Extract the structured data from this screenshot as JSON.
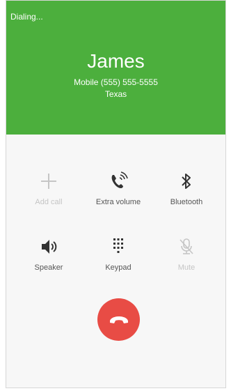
{
  "call": {
    "status": "Dialing...",
    "name": "James",
    "number": "Mobile (555) 555-5555",
    "location": "Texas"
  },
  "controls": [
    {
      "label": "Add call",
      "icon": "plus-icon",
      "enabled": false
    },
    {
      "label": "Extra volume",
      "icon": "phone-volume-icon",
      "enabled": true
    },
    {
      "label": "Bluetooth",
      "icon": "bluetooth-icon",
      "enabled": true
    },
    {
      "label": "Speaker",
      "icon": "speaker-icon",
      "enabled": true
    },
    {
      "label": "Keypad",
      "icon": "keypad-icon",
      "enabled": true
    },
    {
      "label": "Mute",
      "icon": "mute-mic-icon",
      "enabled": false
    }
  ],
  "end_call": {
    "icon": "end-call-icon",
    "color": "#e84c45"
  },
  "colors": {
    "header": "#4caf3d",
    "enabled_icon": "#333333",
    "disabled_icon": "#c5c5c5"
  }
}
